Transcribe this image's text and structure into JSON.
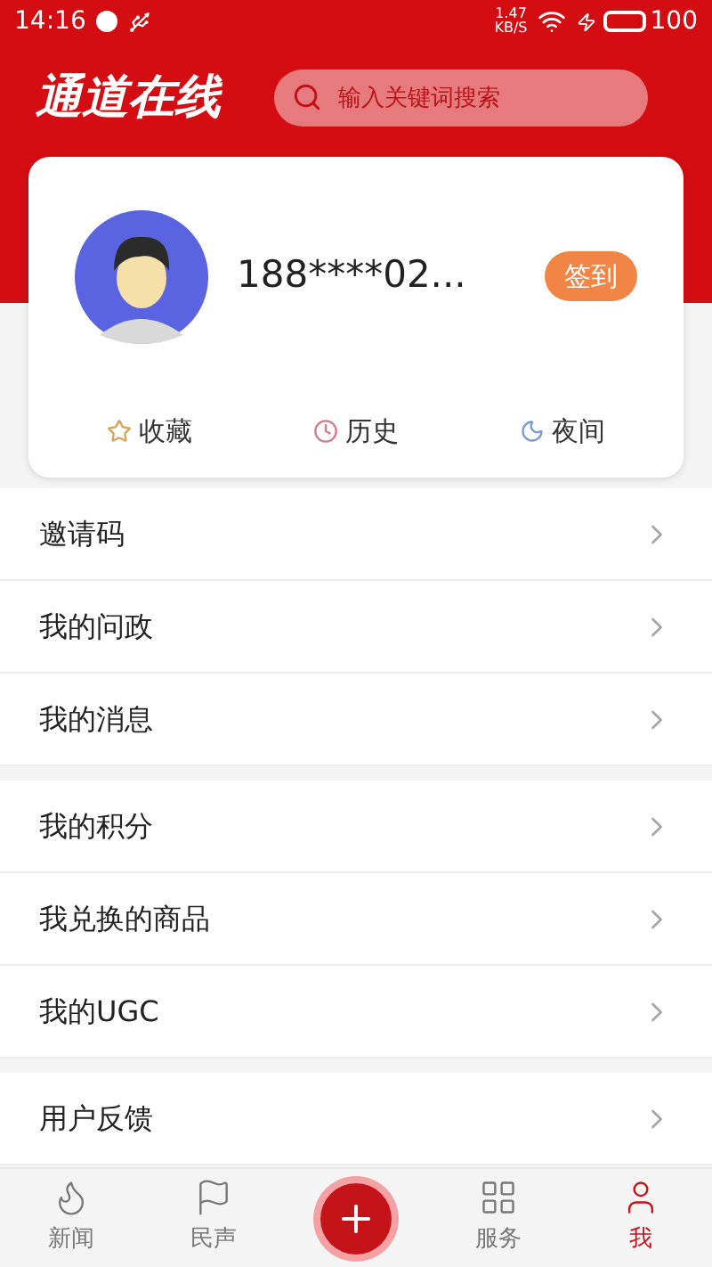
{
  "status_bar": {
    "time": "14:16",
    "speed": "1.47",
    "speed_unit": "KB/S",
    "battery": "100"
  },
  "header": {
    "logo": "通道在线",
    "search": {
      "placeholder": "输入关键词搜索"
    }
  },
  "profile": {
    "name": "188****02...",
    "checkin_button": "签到",
    "actions": [
      {
        "kind": "star",
        "label": "收藏"
      },
      {
        "kind": "clock",
        "label": "历史"
      },
      {
        "kind": "moon",
        "label": "夜间"
      }
    ]
  },
  "menu_groups": [
    [
      {
        "label": "邀请码"
      },
      {
        "label": "我的问政"
      },
      {
        "label": "我的消息"
      }
    ],
    [
      {
        "label": "我的积分"
      },
      {
        "label": "我兑换的商品"
      },
      {
        "label": "我的UGC"
      }
    ],
    [
      {
        "label": "用户反馈"
      }
    ]
  ],
  "tab_bar": [
    {
      "kind": "flame",
      "label": "新闻",
      "selected": false
    },
    {
      "kind": "flag",
      "label": "民声",
      "selected": false
    },
    {
      "kind": "plus",
      "selected": false
    },
    {
      "kind": "grid",
      "label": "服务",
      "selected": false
    },
    {
      "kind": "person",
      "label": "我",
      "selected": true
    }
  ]
}
